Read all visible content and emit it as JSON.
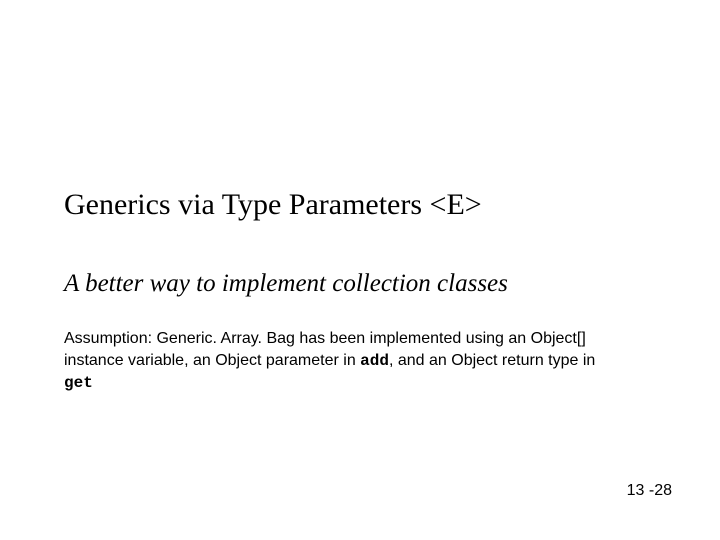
{
  "slide": {
    "title": "Generics via Type Parameters <E>",
    "subtitle": "A better way to implement collection classes",
    "assumption_prefix": "Assumption: Generic. Array. Bag has been implemented using an Object[] instance variable, an Object parameter in ",
    "code_add": "add",
    "assumption_mid": ", and an Object return type in ",
    "code_get": "get",
    "page_number": "13 -28"
  }
}
